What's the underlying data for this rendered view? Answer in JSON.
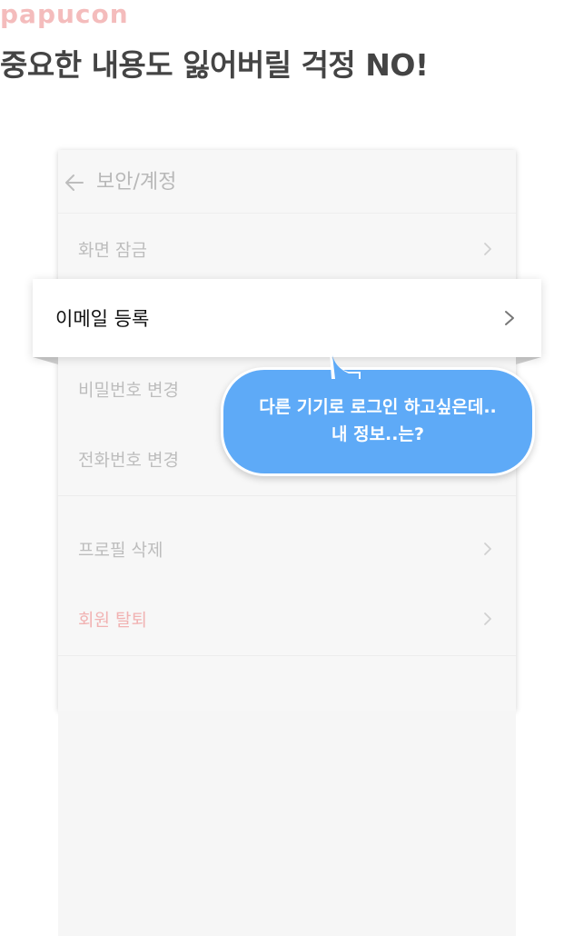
{
  "brand": "papucon",
  "headline": "중요한 내용도 잃어버릴 걱정 NO!",
  "screen": {
    "title": "보안/계정",
    "back_icon": "arrow-left-icon",
    "items": [
      {
        "label": "화면 잠금"
      },
      {
        "label": "이메일 등록"
      },
      {
        "label": "비밀번호 변경"
      },
      {
        "label": "전화번호 변경"
      },
      {
        "label": "프로필 삭제"
      },
      {
        "label": "회원 탈퇴"
      }
    ]
  },
  "bubble": {
    "line1": "다른 기기로 로그인 하고싶은데..",
    "line2": "내 정보..는?"
  },
  "colors": {
    "brand": "#f4bcbc",
    "headline": "#444444",
    "bubble": "#5eaaf7",
    "danger": "#f1b2b2",
    "muted_text": "#bdbdbd"
  }
}
